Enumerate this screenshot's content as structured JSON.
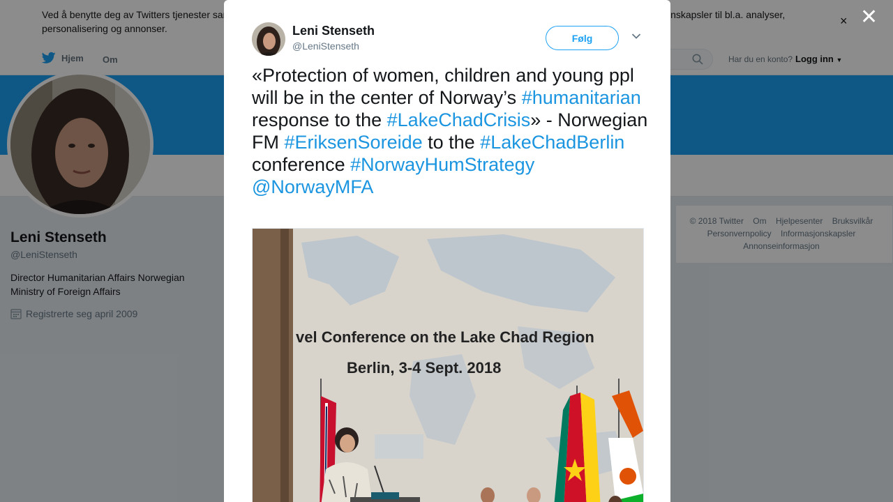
{
  "cookie": {
    "text": "Ved å benytte deg av Twitters tjenester samtykker du i vår bruk av informasjonskapsler og at informasjon overføres til Twitter. Vi bruker informasjonskapsler til bl.a. analyser, personalisering og annonser."
  },
  "nav": {
    "home": "Hjem",
    "about": "Om",
    "login_question": "Har du en konto?",
    "login": "Logg inn"
  },
  "profile": {
    "name": "Leni Stenseth",
    "handle": "@LeniStenseth",
    "bio": "Director Humanitarian Affairs Norwegian Ministry of Foreign Affairs",
    "joined": "Registrerte seg april 2009"
  },
  "footer": {
    "links": [
      "© 2018 Twitter",
      "Om",
      "Hjelpesenter",
      "Bruksvilkår",
      "Personvernpolicy",
      "Informasjonskapsler",
      "Annonseinformasjon"
    ]
  },
  "tweet": {
    "name": "Leni Stenseth",
    "handle": "@LeniStenseth",
    "follow_label": "Følg",
    "text": {
      "t1": "«Protection of women, children and young ppl will be in the center of Norway’s ",
      "h1": "#humanitarian",
      "t2": " response to the ",
      "h2": "#LakeChadCrisis",
      "t3": "» - Norwegian FM ",
      "h3": "#EriksenSoreide",
      "t4": " to the ",
      "h4": "#LakeChadBerlin",
      "t5": " conference ",
      "h5": "#NorwayHumStrategy",
      "t6": " ",
      "m1": "@NorwayMFA"
    },
    "photo": {
      "sign_line1": "vel Conference on the Lake Chad Region",
      "sign_line2": "Berlin, 3-4 Sept. 2018"
    }
  },
  "colors": {
    "twitter_blue": "#1da1f2",
    "link_blue": "#1b95e0"
  },
  "icons": {
    "overlay_close": "close-icon",
    "cookie_close": "close-icon",
    "home": "twitter-bird-icon",
    "search": "search-icon",
    "caret": "chevron-down-icon",
    "calendar": "calendar-icon"
  }
}
